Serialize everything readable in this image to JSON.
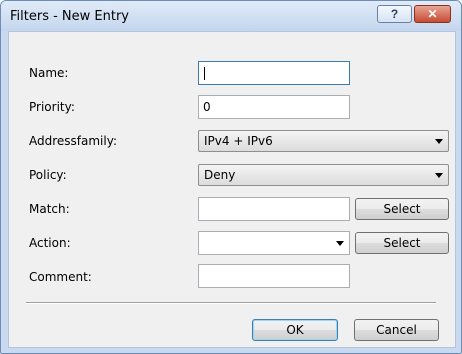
{
  "window": {
    "title": "Filters - New Entry",
    "help_glyph": "?",
    "close_glyph": "✕"
  },
  "form": {
    "name": {
      "label": "Name:",
      "value": ""
    },
    "priority": {
      "label": "Priority:",
      "value": "0"
    },
    "addressfamily": {
      "label": "Addressfamily:",
      "value": "IPv4 + IPv6"
    },
    "policy": {
      "label": "Policy:",
      "value": "Deny"
    },
    "match": {
      "label": "Match:",
      "value": "",
      "button": "Select"
    },
    "action": {
      "label": "Action:",
      "value": "",
      "button": "Select"
    },
    "comment": {
      "label": "Comment:",
      "value": ""
    }
  },
  "buttons": {
    "ok": "OK",
    "cancel": "Cancel"
  }
}
